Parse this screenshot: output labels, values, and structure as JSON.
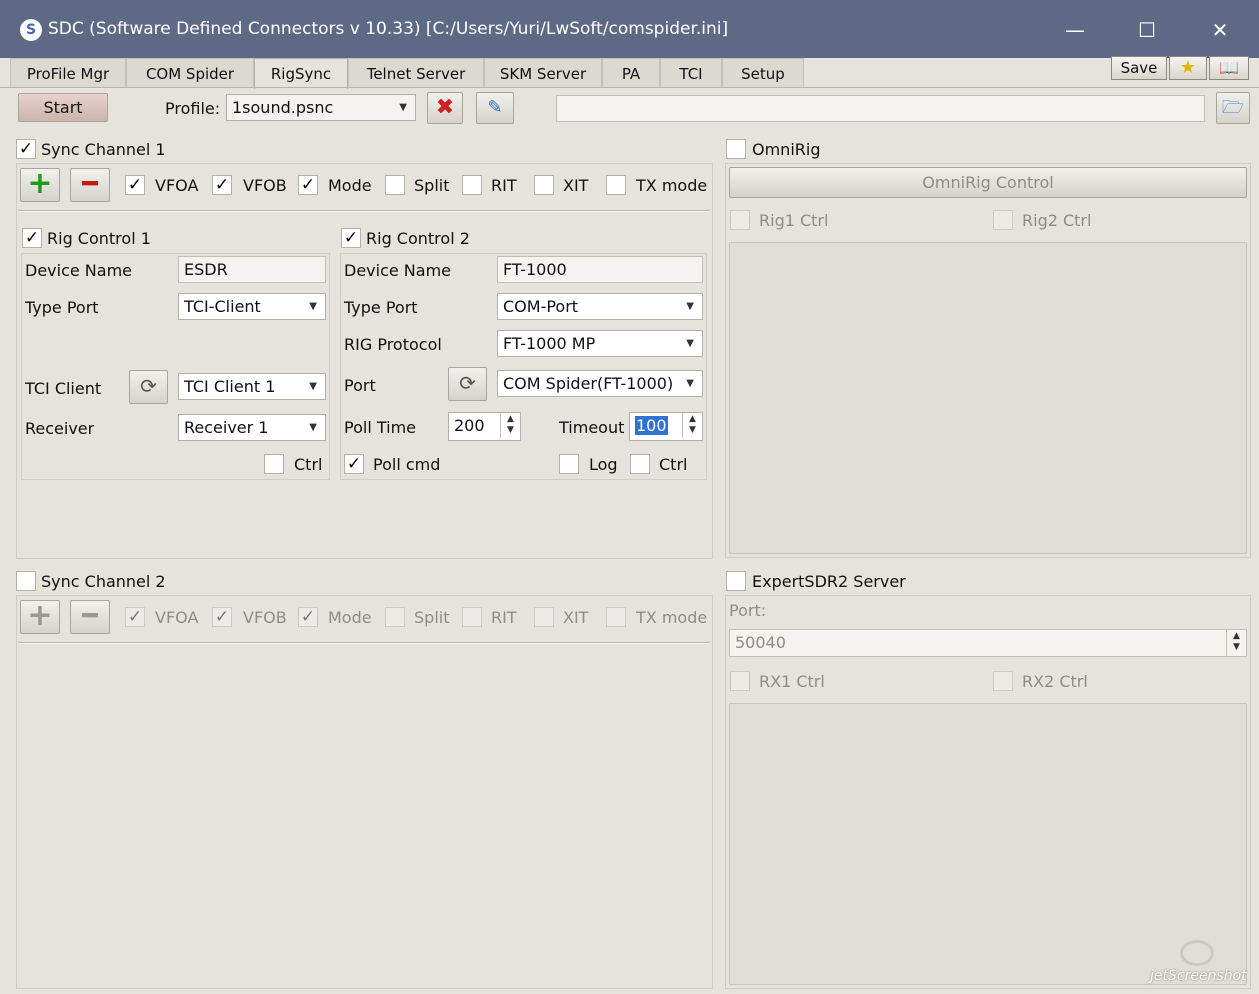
{
  "window": {
    "title": "SDC (Software Defined Connectors v 10.33) [C:/Users/Yuri/LwSoft/comspider.ini]",
    "app_icon": "S"
  },
  "tabs": [
    "ProFile Mgr",
    "COM Spider",
    "RigSync",
    "Telnet Server",
    "SKM Server",
    "PA",
    "TCI",
    "Setup"
  ],
  "header_buttons": {
    "save": "Save"
  },
  "toolbar": {
    "start": "Start",
    "profile_label": "Profile:",
    "profile_value": "1sound.psnc",
    "path_value": ""
  },
  "sync1": {
    "title": "Sync Channel 1",
    "options": [
      {
        "label": "VFOA",
        "checked": true
      },
      {
        "label": "VFOB",
        "checked": true
      },
      {
        "label": "Mode",
        "checked": true
      },
      {
        "label": "Split",
        "checked": false
      },
      {
        "label": "RIT",
        "checked": false
      },
      {
        "label": "XIT",
        "checked": false
      },
      {
        "label": "TX mode",
        "checked": false
      }
    ],
    "rig1": {
      "title": "Rig Control 1",
      "device_name_label": "Device Name",
      "device_name": "ESDR",
      "type_port_label": "Type Port",
      "type_port": "TCI-Client",
      "tci_client_label": "TCI Client",
      "tci_client": "TCI Client 1",
      "receiver_label": "Receiver",
      "receiver": "Receiver 1",
      "ctrl_label": "Ctrl"
    },
    "rig2": {
      "title": "Rig Control 2",
      "device_name_label": "Device Name",
      "device_name": "FT-1000",
      "type_port_label": "Type Port",
      "type_port": "COM-Port",
      "protocol_label": "RIG Protocol",
      "protocol": "FT-1000 MP",
      "port_label": "Port",
      "port": "COM Spider(FT-1000)",
      "poll_time_label": "Poll Time",
      "poll_time": "200",
      "timeout_label": "Timeout",
      "timeout": "100",
      "poll_cmd_label": "Poll cmd",
      "log_label": "Log",
      "ctrl_label": "Ctrl"
    }
  },
  "sync2": {
    "title": "Sync Channel 2",
    "options": [
      {
        "label": "VFOA",
        "checked": true
      },
      {
        "label": "VFOB",
        "checked": true
      },
      {
        "label": "Mode",
        "checked": true
      },
      {
        "label": "Split",
        "checked": false
      },
      {
        "label": "RIT",
        "checked": false
      },
      {
        "label": "XIT",
        "checked": false
      },
      {
        "label": "TX mode",
        "checked": false
      }
    ]
  },
  "omnirig": {
    "title": "OmniRig",
    "control_button": "OmniRig Control",
    "rig1": "Rig1 Ctrl",
    "rig2": "Rig2 Ctrl"
  },
  "expert": {
    "title": "ExpertSDR2 Server",
    "port_label": "Port:",
    "port_value": "50040",
    "rx1": "RX1 Ctrl",
    "rx2": "RX2 Ctrl"
  },
  "watermark": "jetScreenshot",
  "colors": {
    "title_bar": "#5e6a85",
    "plus_green": "#1f9a1f",
    "minus_red": "#c41818",
    "selection": "#2f72d6"
  }
}
